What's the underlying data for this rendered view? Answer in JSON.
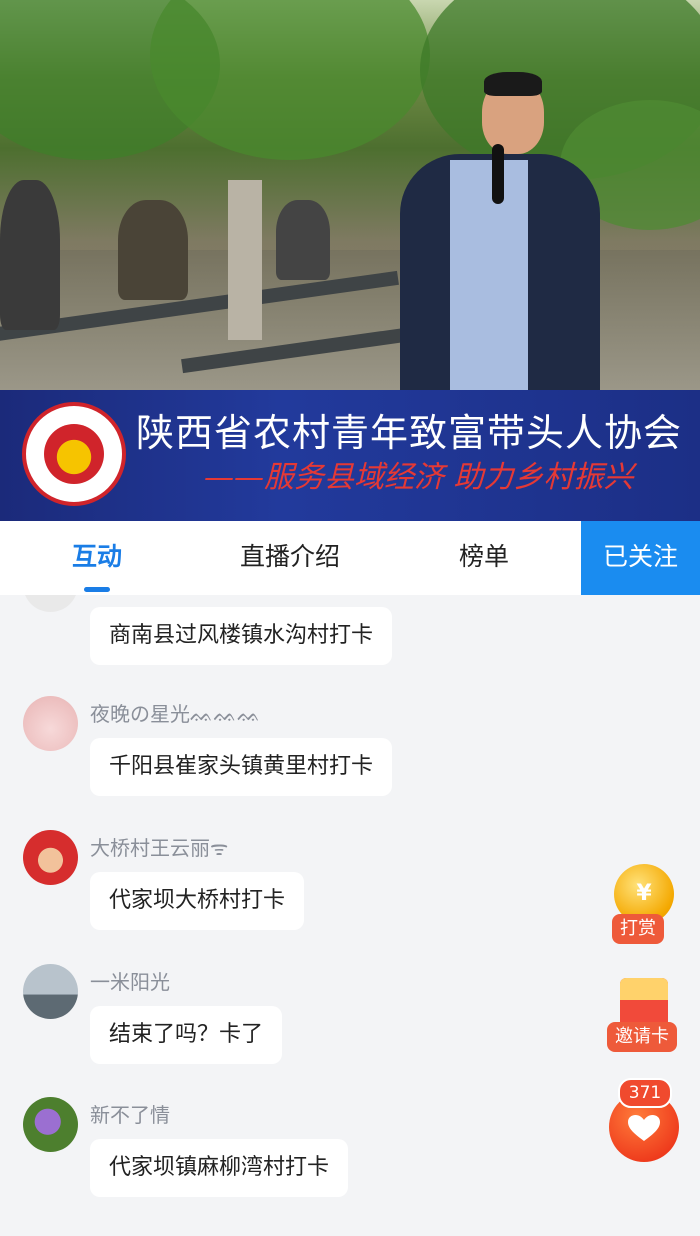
{
  "banner": {
    "title": "陕西省农村青年致富带头人协会",
    "slogan": "——服务县域经济 助力乡村振兴"
  },
  "tabs": [
    {
      "label": "互动",
      "active": true
    },
    {
      "label": "直播介绍",
      "active": false
    },
    {
      "label": "榜单",
      "active": false
    }
  ],
  "follow_button": "已关注",
  "comments": [
    {
      "user": "",
      "text": "商南县过风楼镇水沟村打卡"
    },
    {
      "user": "夜晚の星光ᨐᨐᨐ᠌",
      "text": "千阳县崔家头镇黄里村打卡"
    },
    {
      "user": "大桥村王云丽ᯤ",
      "text": "代家坝大桥村打卡"
    },
    {
      "user": "一米阳光",
      "text": "结束了吗？卡了"
    },
    {
      "user": "新不了情",
      "text": "代家坝镇麻柳湾村打卡"
    }
  ],
  "actions": {
    "reward_label": "打赏",
    "reward_coin_symbol": "¥",
    "invite_label": "邀请卡",
    "like_count": "371"
  },
  "colors": {
    "accent": "#1a7de6",
    "follow_bg": "#1a8cf0",
    "banner_bg": "#1b2a7a",
    "action_red": "#ee5a3a"
  }
}
